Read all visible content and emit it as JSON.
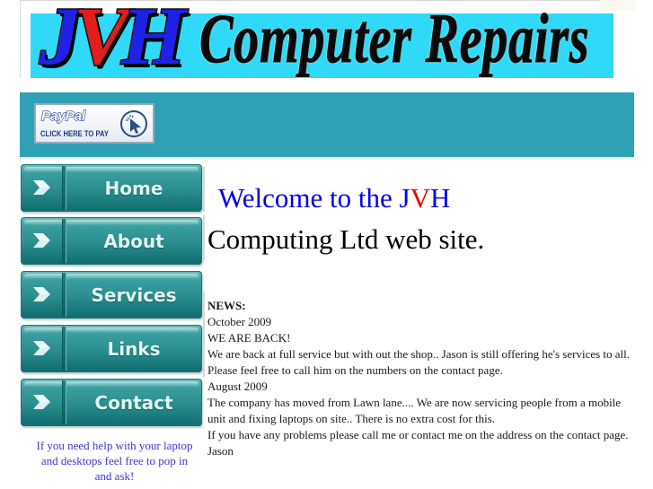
{
  "header": {
    "logo_letters": [
      "J",
      "V",
      "H"
    ],
    "logo_colors": {
      "J": "#1f22e6",
      "V": "#e21d1d",
      "H": "#1f22e6"
    },
    "title": "Computer Repairs",
    "banner_colors": {
      "top": "#2fd9f7",
      "bottom": "#2ea1b4"
    }
  },
  "paypal": {
    "brand": "PayPal",
    "cta": "CLICK HERE TO PAY",
    "icon": "cursor-click-icon"
  },
  "nav": {
    "items": [
      {
        "label": "Home",
        "icon": "chevron-right-icon"
      },
      {
        "label": "About",
        "icon": "chevron-right-icon"
      },
      {
        "label": "Services",
        "icon": "chevron-right-icon"
      },
      {
        "label": "Links",
        "icon": "chevron-right-icon"
      },
      {
        "label": "Contact",
        "icon": "chevron-right-icon"
      }
    ],
    "help_text": "If you need help with your laptop and desktops feel free to pop in and ask!"
  },
  "main": {
    "welcome_prefix": "Welcome to the ",
    "welcome_j": "J",
    "welcome_v": "V",
    "welcome_h": "H",
    "welcome_line2": "Computing Ltd web site.",
    "news": {
      "title": "NEWS:",
      "lines": [
        "October 2009",
        "WE ARE BACK!",
        "We are back at full service but with out the shop.. Jason is still offering he's services to all.  Please feel free to call him on the numbers on the contact page.",
        "August 2009",
        "The company has moved from Lawn lane.... We are now servicing people from a mobile unit and fixing laptops on site.. There is no extra cost for this.",
        "If you have any problems please call me or contact me on the address on the contact page.",
        "Jason"
      ]
    }
  }
}
